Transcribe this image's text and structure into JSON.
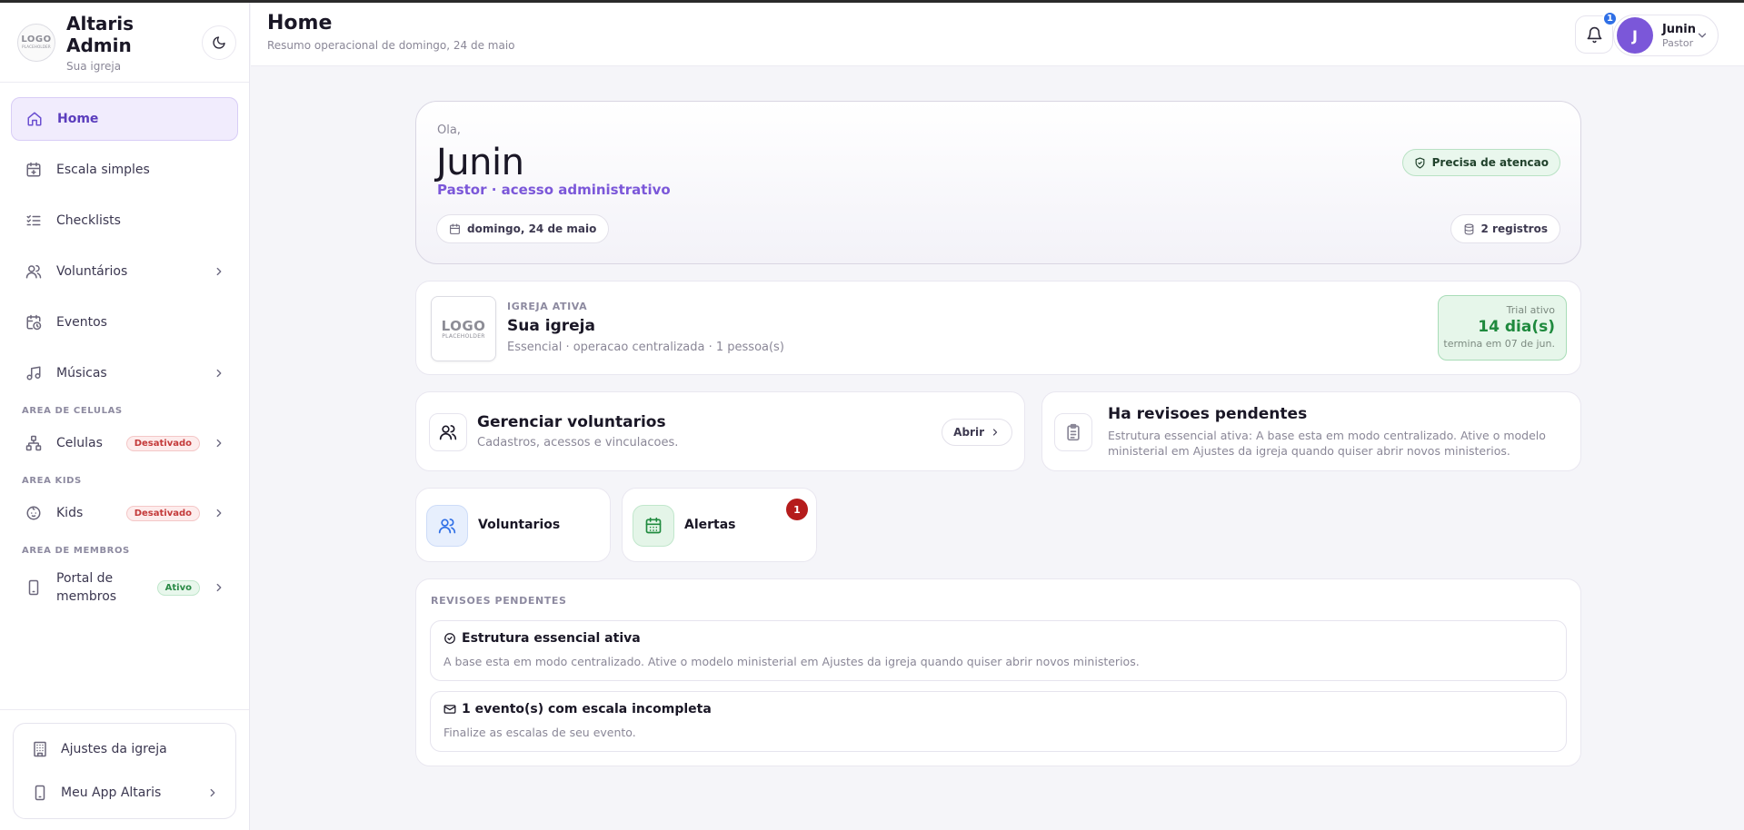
{
  "sidebar": {
    "brand": {
      "logo_line1": "LOGO",
      "logo_line2": "PLACEHOLDER",
      "title": "Altaris Admin",
      "subtitle": "Sua igreja"
    },
    "nav": [
      {
        "label": "Home",
        "icon": "home-icon",
        "active": true
      },
      {
        "label": "Escala simples",
        "icon": "calendar-plus-icon"
      },
      {
        "label": "Checklists",
        "icon": "checklist-icon"
      },
      {
        "label": "Voluntários",
        "icon": "users-icon",
        "chevron": true
      },
      {
        "label": "Eventos",
        "icon": "calendar-clock-icon"
      },
      {
        "label": "Músicas",
        "icon": "music-icon",
        "chevron": true
      }
    ],
    "sections": [
      {
        "title": "AREA DE CELULAS",
        "item": {
          "label": "Celulas",
          "icon": "network-icon",
          "badge": "Desativado"
        }
      },
      {
        "title": "AREA KIDS",
        "item": {
          "label": "Kids",
          "icon": "baby-icon",
          "badge": "Desativado"
        }
      },
      {
        "title": "AREA DE MEMBROS",
        "item": {
          "label": "Portal de membros",
          "label_line1": "Portal de",
          "label_line2": "membros",
          "icon": "smartphone-icon",
          "badge": "Ativo"
        }
      }
    ],
    "footer": [
      {
        "label": "Ajustes da igreja",
        "icon": "building-icon"
      },
      {
        "label": "Meu App Altaris",
        "icon": "smartphone-icon",
        "chevron": true
      }
    ]
  },
  "header": {
    "title": "Home",
    "subtitle": "Resumo operacional de domingo, 24 de maio",
    "notifications_count": "1",
    "user": {
      "initial": "J",
      "name": "Junin",
      "role": "Pastor"
    }
  },
  "hero": {
    "greeting": "Ola,",
    "name": "Junin",
    "role": "Pastor · acesso administrativo",
    "status": "Precisa de atencao",
    "date_chip": "domingo, 24 de maio",
    "records_chip": "2 registros"
  },
  "church": {
    "logo_line1": "LOGO",
    "logo_line2": "PLACEHOLDER",
    "kicker": "IGREJA ATIVA",
    "name": "Sua igreja",
    "meta": "Essencial · operacao centralizada · 1 pessoa(s)",
    "trial_label": "Trial ativo",
    "trial_days": "14 dia(s)",
    "trial_end": "termina em 07 de jun."
  },
  "manage": {
    "title": "Gerenciar voluntarios",
    "subtitle": "Cadastros, acessos e vinculacoes.",
    "button": "Abrir"
  },
  "pending": {
    "title": "Ha revisoes pendentes",
    "text": "Estrutura essencial ativa: A base esta em modo centralizado. Ative o modelo ministerial em Ajustes da igreja quando quiser abrir novos ministerios."
  },
  "tiles": [
    {
      "label": "Voluntarios",
      "icon": "users-icon",
      "color": "#2f6fe6"
    },
    {
      "label": "Alertas",
      "icon": "calendar-icon",
      "color": "#1f8a3e",
      "badge": "1"
    }
  ],
  "reviews": {
    "title": "REVISOES PENDENTES",
    "items": [
      {
        "title": "Estrutura essencial ativa",
        "icon": "check-circle-icon",
        "text": "A base esta em modo centralizado. Ative o modelo ministerial em Ajustes da igreja quando quiser abrir novos ministerios."
      },
      {
        "title": "1 evento(s) com escala incompleta",
        "icon": "mail-icon",
        "text": "Finalize as escalas de seu evento."
      }
    ]
  },
  "colors": {
    "accent": "#7b57d9",
    "active_bg": "#f1ecfd",
    "danger": "#c43a3a",
    "success": "#1f8a3e",
    "info": "#2f6fe6"
  }
}
